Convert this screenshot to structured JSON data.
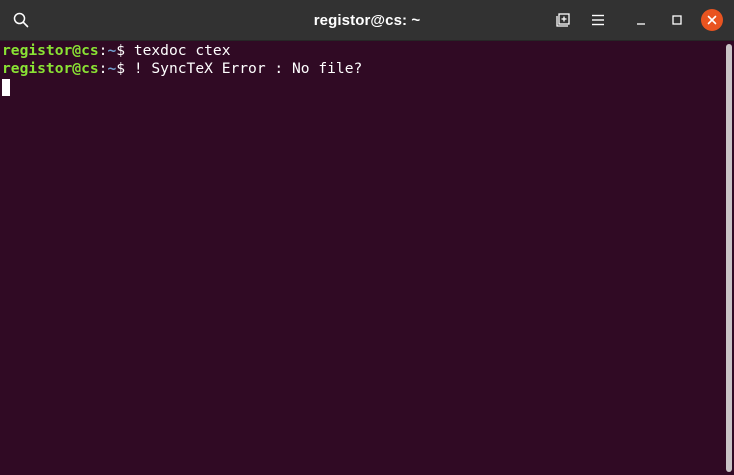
{
  "window": {
    "title": "registor@cs: ~"
  },
  "titlebar": {
    "icons": {
      "search": "search-icon",
      "new_tab": "new-tab-icon",
      "menu": "hamburger-menu-icon",
      "minimize": "minimize-icon",
      "maximize": "maximize-icon",
      "close": "close-icon"
    },
    "close_color": "#e95420"
  },
  "terminal": {
    "lines": [
      {
        "user_host": "registor@cs",
        "colon": ":",
        "path": "~",
        "prompt": "$ ",
        "command": "texdoc ctex"
      },
      {
        "user_host": "registor@cs",
        "colon": ":",
        "path": "~",
        "prompt": "$ ",
        "command": "! SyncTeX Error : No file?"
      }
    ],
    "colors": {
      "background": "#300a24",
      "user_host": "#8ae234",
      "path": "#729fcf",
      "text": "#ffffff"
    }
  }
}
